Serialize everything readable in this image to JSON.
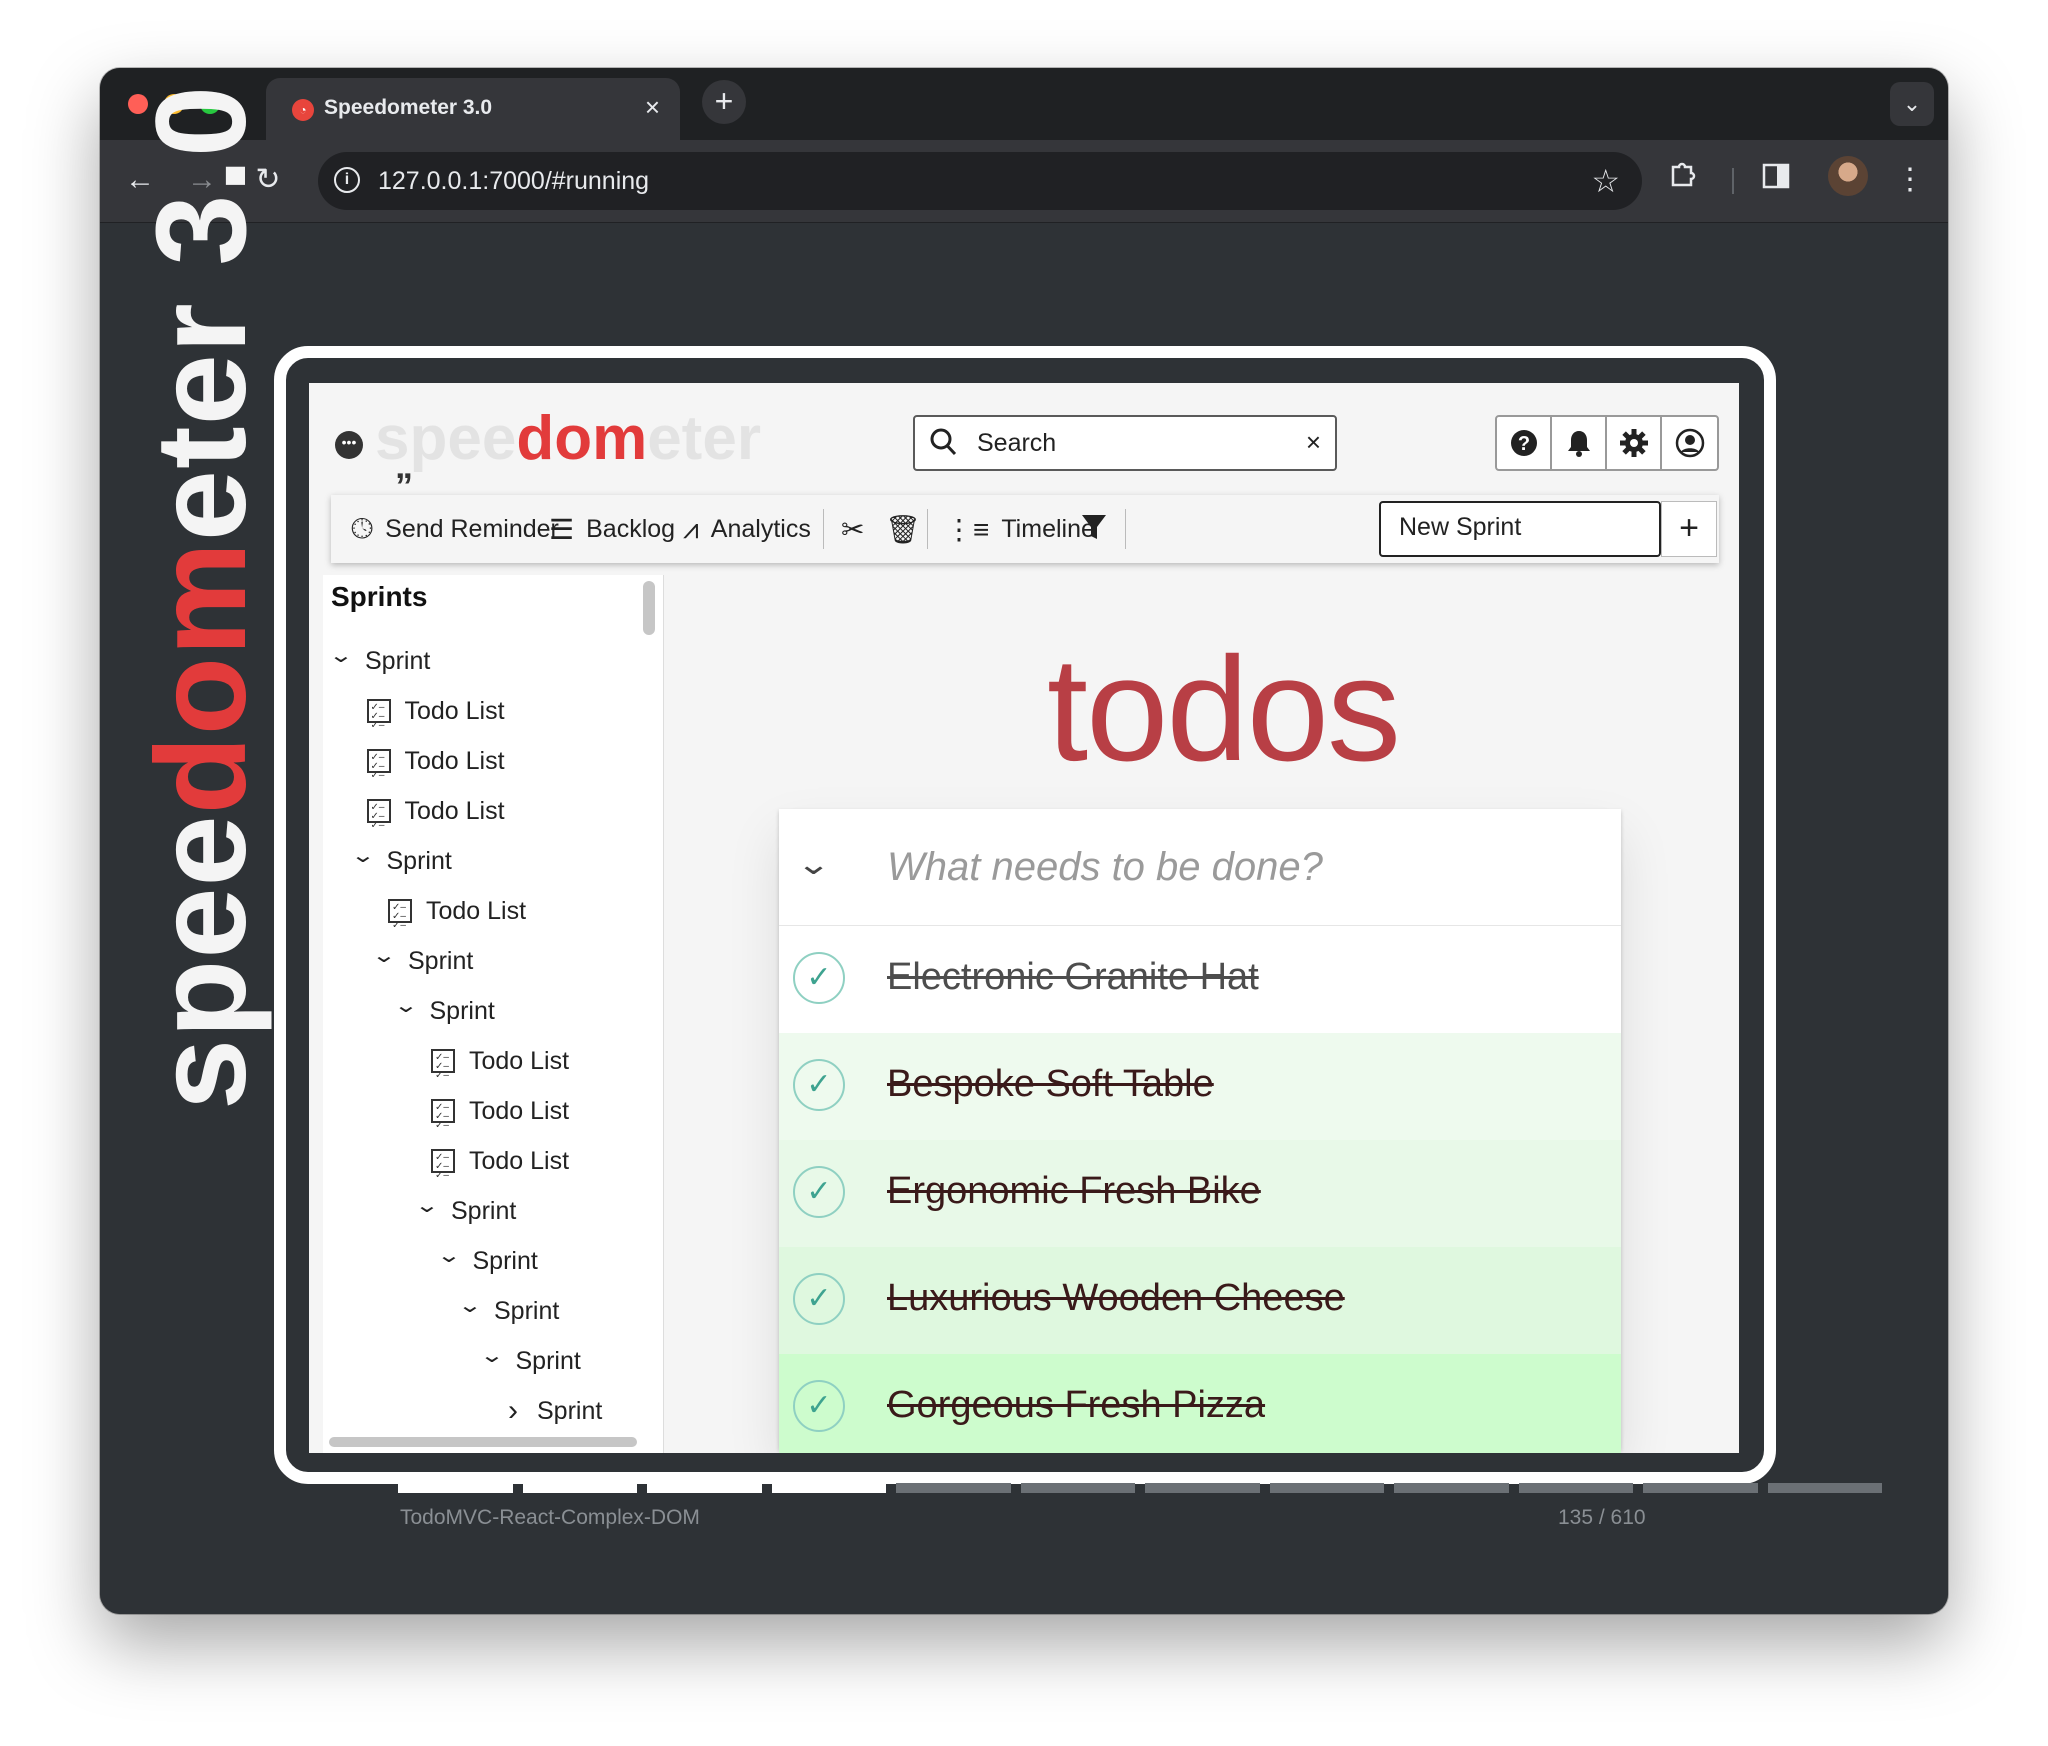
{
  "browser": {
    "tab_title": "Speedometer 3.0",
    "tab_close": "×",
    "new_tab": "+",
    "tab_search": "⌄",
    "url": "127.0.0.1:7000/#running",
    "info": "i",
    "star": "☆"
  },
  "side_logo": {
    "speed": "spee",
    "dom": "dom",
    "eter": "eter",
    "version": " 3.0"
  },
  "app": {
    "logo_light_1": "spee",
    "logo_dom": "dom",
    "logo_light_2": "eter",
    "logo_dots": "•••",
    "logo_mark": "„",
    "search_placeholder": "Search",
    "search_clear": "×",
    "header_icons": [
      "question-icon",
      "bell-icon",
      "gear-icon",
      "user-icon"
    ],
    "actions": {
      "send_reminder": "Send Reminder",
      "backlog": "Backlog",
      "analytics": "Analytics",
      "timeline": "Timeline"
    },
    "new_sprint_value": "New Sprint",
    "add": "+"
  },
  "sidebar": {
    "title": "Sprints",
    "items": [
      {
        "type": "sprint",
        "label": "Sprint",
        "depth": 0,
        "expanded": true
      },
      {
        "type": "list",
        "label": "Todo List",
        "depth": 1
      },
      {
        "type": "list",
        "label": "Todo List",
        "depth": 1
      },
      {
        "type": "list",
        "label": "Todo List",
        "depth": 1
      },
      {
        "type": "sprint",
        "label": "Sprint",
        "depth": 1,
        "expanded": true
      },
      {
        "type": "list",
        "label": "Todo List",
        "depth": 2
      },
      {
        "type": "sprint",
        "label": "Sprint",
        "depth": 2,
        "expanded": true
      },
      {
        "type": "sprint",
        "label": "Sprint",
        "depth": 3,
        "expanded": true
      },
      {
        "type": "list",
        "label": "Todo List",
        "depth": 4
      },
      {
        "type": "list",
        "label": "Todo List",
        "depth": 4
      },
      {
        "type": "list",
        "label": "Todo List",
        "depth": 4
      },
      {
        "type": "sprint",
        "label": "Sprint",
        "depth": 4,
        "expanded": true
      },
      {
        "type": "sprint",
        "label": "Sprint",
        "depth": 5,
        "expanded": true
      },
      {
        "type": "sprint",
        "label": "Sprint",
        "depth": 6,
        "expanded": true
      },
      {
        "type": "sprint",
        "label": "Sprint",
        "depth": 7,
        "expanded": true
      },
      {
        "type": "sprint",
        "label": "Sprint",
        "depth": 8,
        "expanded": false
      }
    ]
  },
  "todos": {
    "title": "todos",
    "placeholder": "What needs to be done?",
    "items": [
      {
        "label": "Electronic Granite Hat",
        "completed": true,
        "bg": "#ffffff",
        "color": "#4d4d4d"
      },
      {
        "label": "Bespoke Soft Table",
        "completed": true,
        "bg": "#eefaee",
        "color": "#3a1a1a"
      },
      {
        "label": "Ergonomic Fresh Bike",
        "completed": true,
        "bg": "#e8f9e8",
        "color": "#3a1a1a"
      },
      {
        "label": "Luxurious Wooden Cheese",
        "completed": true,
        "bg": "#dff8df",
        "color": "#3a1a1a"
      },
      {
        "label": "Gorgeous Fresh Pizza",
        "completed": true,
        "bg": "#cdfccd",
        "color": "#3a1a1a"
      }
    ]
  },
  "progress": {
    "completed_segments": 4,
    "total_segments": 12,
    "suite_name": "TodoMVC-React-Complex-DOM",
    "counter": "135 / 610"
  },
  "colors": {
    "accent_red": "#e23b3b",
    "todos_red": "#b83f45",
    "window_bg": "#2e3236"
  }
}
